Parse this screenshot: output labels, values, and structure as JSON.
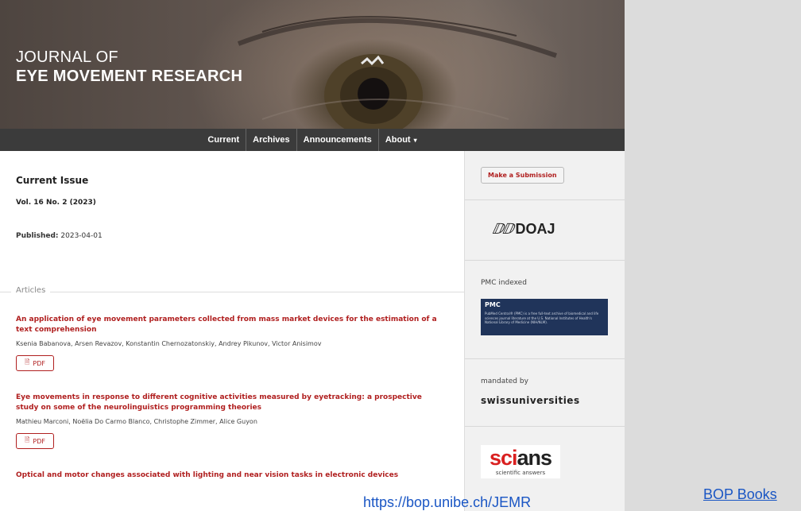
{
  "header": {
    "title_line1": "JOURNAL OF",
    "title_line2": "EYE MOVEMENT RESEARCH"
  },
  "nav": {
    "items": [
      "Current",
      "Archives",
      "Announcements",
      "About"
    ],
    "about_caret": "▾"
  },
  "issue": {
    "heading": "Current Issue",
    "volume": "Vol. 16 No. 2 (2023)",
    "published_label": "Published:",
    "published_date": "2023-04-01",
    "section_label": "Articles"
  },
  "articles": [
    {
      "title": "An application of eye movement parameters collected from mass market devices for the estimation of a text comprehension",
      "authors": "Ksenia Babanova, Arsen Revazov, Konstantin Chernozatonskiy, Andrey Pikunov, Victor Anisimov",
      "pdf_label": "PDF"
    },
    {
      "title": "Eye movements in response to different cognitive activities measured by eyetracking: a prospective study on some of the neurolinguistics programming theories",
      "authors": "Mathieu Marconi, Noëlia Do Carmo Blanco, Christophe Zimmer, Alice Guyon",
      "pdf_label": "PDF"
    },
    {
      "title": "Optical and motor changes associated with lighting and near vision tasks in electronic devices",
      "authors": "",
      "pdf_label": ""
    }
  ],
  "sidebar": {
    "submit_label": "Make a Submission",
    "doaj_mark": "ⅅⅅ",
    "doaj_text": "DOAJ",
    "pmc_label": "PMC indexed",
    "pmc_title": "PMC",
    "pmc_text": "PubMed Central® (PMC) is a free full-text archive of biomedical and life sciences journal literature at the U.S. National Institutes of Health's National Library of Medicine (NIH/NLM).",
    "mandated_label": "mandated by",
    "swiss_text": "swissuniversities",
    "scians_sci": "sci",
    "scians_ans": "ans",
    "scians_tagline": "scientific answers"
  },
  "footer": {
    "url_text": "https://bop.unibe.ch/JEMR",
    "bop_books": "BOP Books"
  },
  "colors": {
    "accent": "#b01f1f",
    "nav_bg": "#3b3b3b",
    "link": "#1a56c4"
  }
}
